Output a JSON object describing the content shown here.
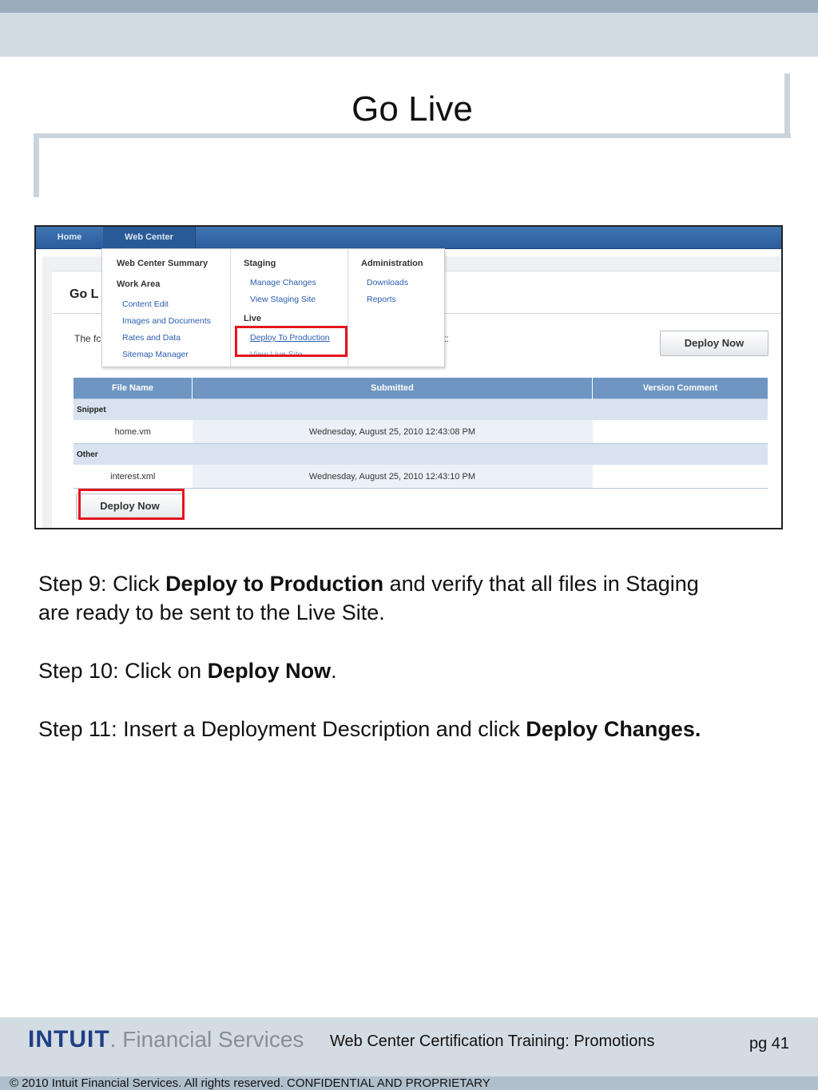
{
  "slide": {
    "title": "Go Live"
  },
  "screenshot": {
    "nav": [
      "Home",
      "Web Center"
    ],
    "menu": {
      "col1_heading": "Web Center Summary",
      "col1_sub": "Work Area",
      "col1_links": [
        "Content Edit",
        "Images and Documents",
        "Rates and Data",
        "Sitemap Manager"
      ],
      "col2_heading": "Staging",
      "col2_links": [
        "Manage Changes",
        "View Staging Site"
      ],
      "col2_sub": "Live",
      "col2_live_links": [
        "Deploy To Production",
        "View Live Site"
      ],
      "col3_heading": "Administration",
      "col3_links": [
        "Downloads",
        "Reports"
      ]
    },
    "page_heading": "Go L",
    "intro_start": "The fc",
    "intro_end": "t:",
    "deploy_button": "Deploy Now",
    "table": {
      "headers": [
        "File Name",
        "Submitted",
        "Version Comment"
      ],
      "groups": [
        {
          "label": "Snippet",
          "file": "home.vm",
          "submitted": "Wednesday, August 25, 2010 12:43:08 PM",
          "comment": ""
        },
        {
          "label": "Other",
          "file": "interest.xml",
          "submitted": "Wednesday, August 25, 2010 12:43:10 PM",
          "comment": ""
        }
      ]
    },
    "highlight_color": "#e5141d"
  },
  "steps": {
    "s9_pre": "Step 9: Click ",
    "s9_bold": "Deploy to Production",
    "s9_post": " and verify that all files in Staging are ready to be sent to the Live Site.",
    "s10_pre": "Step 10: Click on ",
    "s10_bold": "Deploy Now",
    "s10_post": ".",
    "s11_pre": "Step 11: Insert a Deployment Description and click ",
    "s11_bold": "Deploy Changes."
  },
  "footer": {
    "logo_brand": "INTUIT",
    "logo_text": "Financial Services",
    "course": "Web Center Certification Training: Promotions",
    "page": "pg 41",
    "copyright": "© 2010 Intuit Financial Services. All rights reserved. CONFIDENTIAL AND PROPRIETARY"
  }
}
